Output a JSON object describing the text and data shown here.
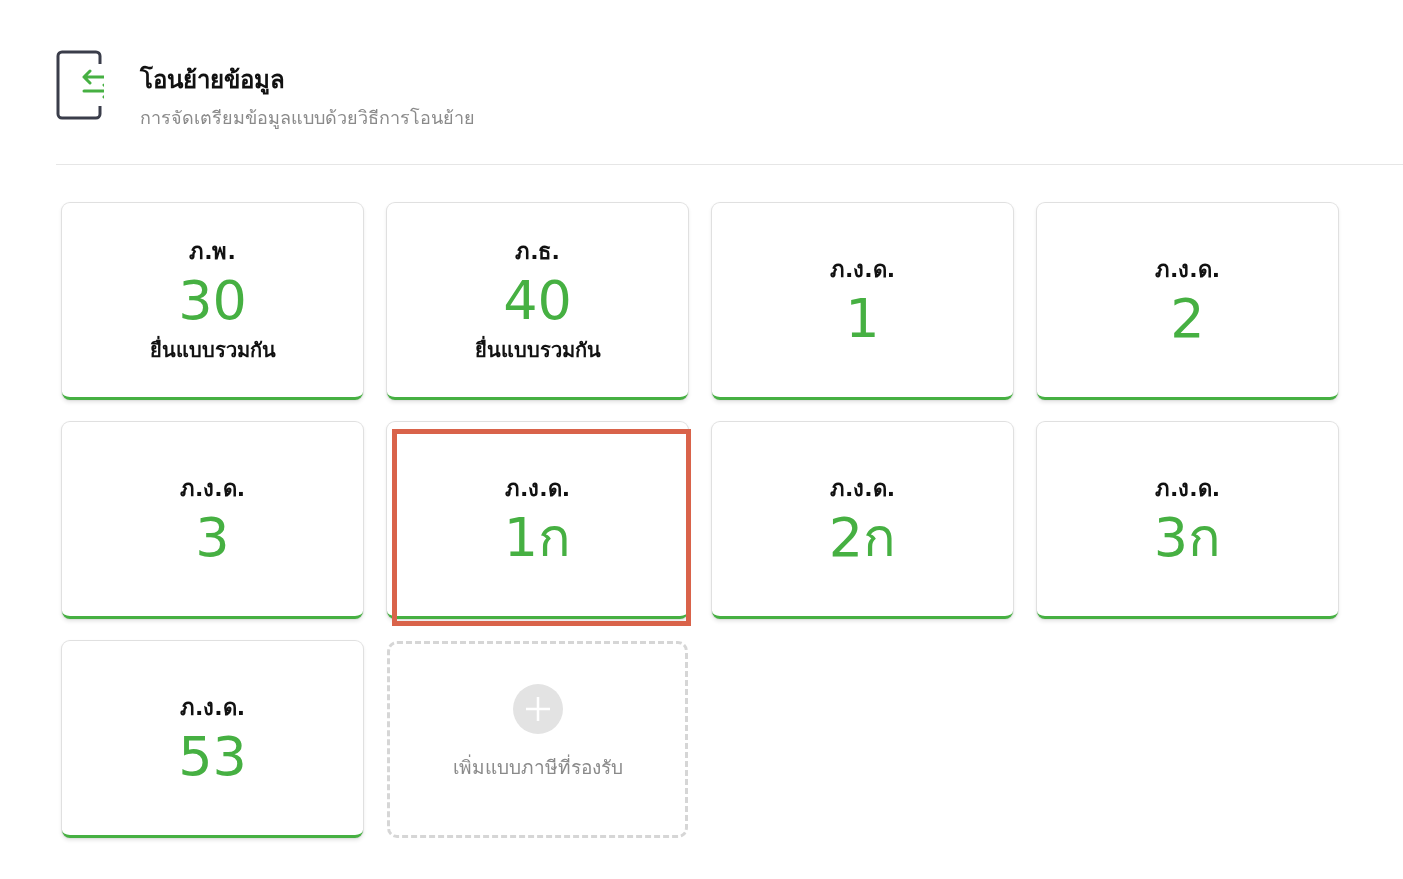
{
  "header": {
    "title": "โอนย้ายข้อมูล",
    "subtitle": "การจัดเตรียมข้อมูลแบบด้วยวิธีการโอนย้าย"
  },
  "cards": [
    {
      "kind": "form",
      "form": "ภ.พ.",
      "number": "30",
      "note": "ยื่นแบบรวมกัน",
      "highlighted": false
    },
    {
      "kind": "form",
      "form": "ภ.ธ.",
      "number": "40",
      "note": "ยื่นแบบรวมกัน",
      "highlighted": false
    },
    {
      "kind": "form",
      "form": "ภ.ง.ด.",
      "number": "1",
      "highlighted": false
    },
    {
      "kind": "form",
      "form": "ภ.ง.ด.",
      "number": "2",
      "highlighted": false
    },
    {
      "kind": "form",
      "form": "ภ.ง.ด.",
      "number": "3",
      "highlighted": false
    },
    {
      "kind": "form",
      "form": "ภ.ง.ด.",
      "number": "1ก",
      "highlighted": true
    },
    {
      "kind": "form",
      "form": "ภ.ง.ด.",
      "number": "2ก",
      "highlighted": false
    },
    {
      "kind": "form",
      "form": "ภ.ง.ด.",
      "number": "3ก",
      "highlighted": false
    },
    {
      "kind": "form",
      "form": "ภ.ง.ด.",
      "number": "53",
      "highlighted": false
    },
    {
      "kind": "add",
      "label": "เพิ่มแบบภาษีที่รองรับ"
    }
  ]
}
